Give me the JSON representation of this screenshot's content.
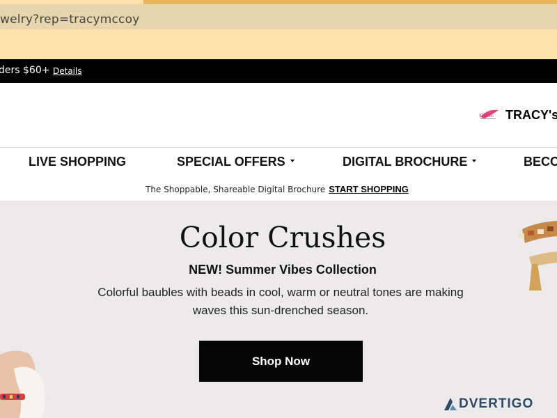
{
  "browser": {
    "url": "welry?rep=tracymccoy"
  },
  "promo": {
    "text": "ders $60+",
    "details_link": "Details"
  },
  "header": {
    "logo_text": "TRACY's"
  },
  "nav": {
    "items": [
      {
        "label": "LIVE SHOPPING"
      },
      {
        "label": "SPECIAL OFFERS"
      },
      {
        "label": "DIGITAL BROCHURE"
      },
      {
        "label": "BECO"
      }
    ]
  },
  "sub_banner": {
    "text": "The Shoppable, Shareable Digital Brochure",
    "link": "START SHOPPING"
  },
  "hero": {
    "title": "Color Crushes",
    "subtitle": "NEW! Summer Vibes Collection",
    "body": "Colorful baubles with beads in cool, warm or neutral tones are making waves this sun-drenched season.",
    "button": "Shop Now"
  },
  "watermark": {
    "text": "DVERTIGO"
  },
  "colors": {
    "chrome": "#fde3a9",
    "url_bar": "#e8d4ad",
    "promo_bar": "#000000",
    "hero_bg": "#eceaea",
    "button": "#050505",
    "watermark": "#2d4a66"
  }
}
